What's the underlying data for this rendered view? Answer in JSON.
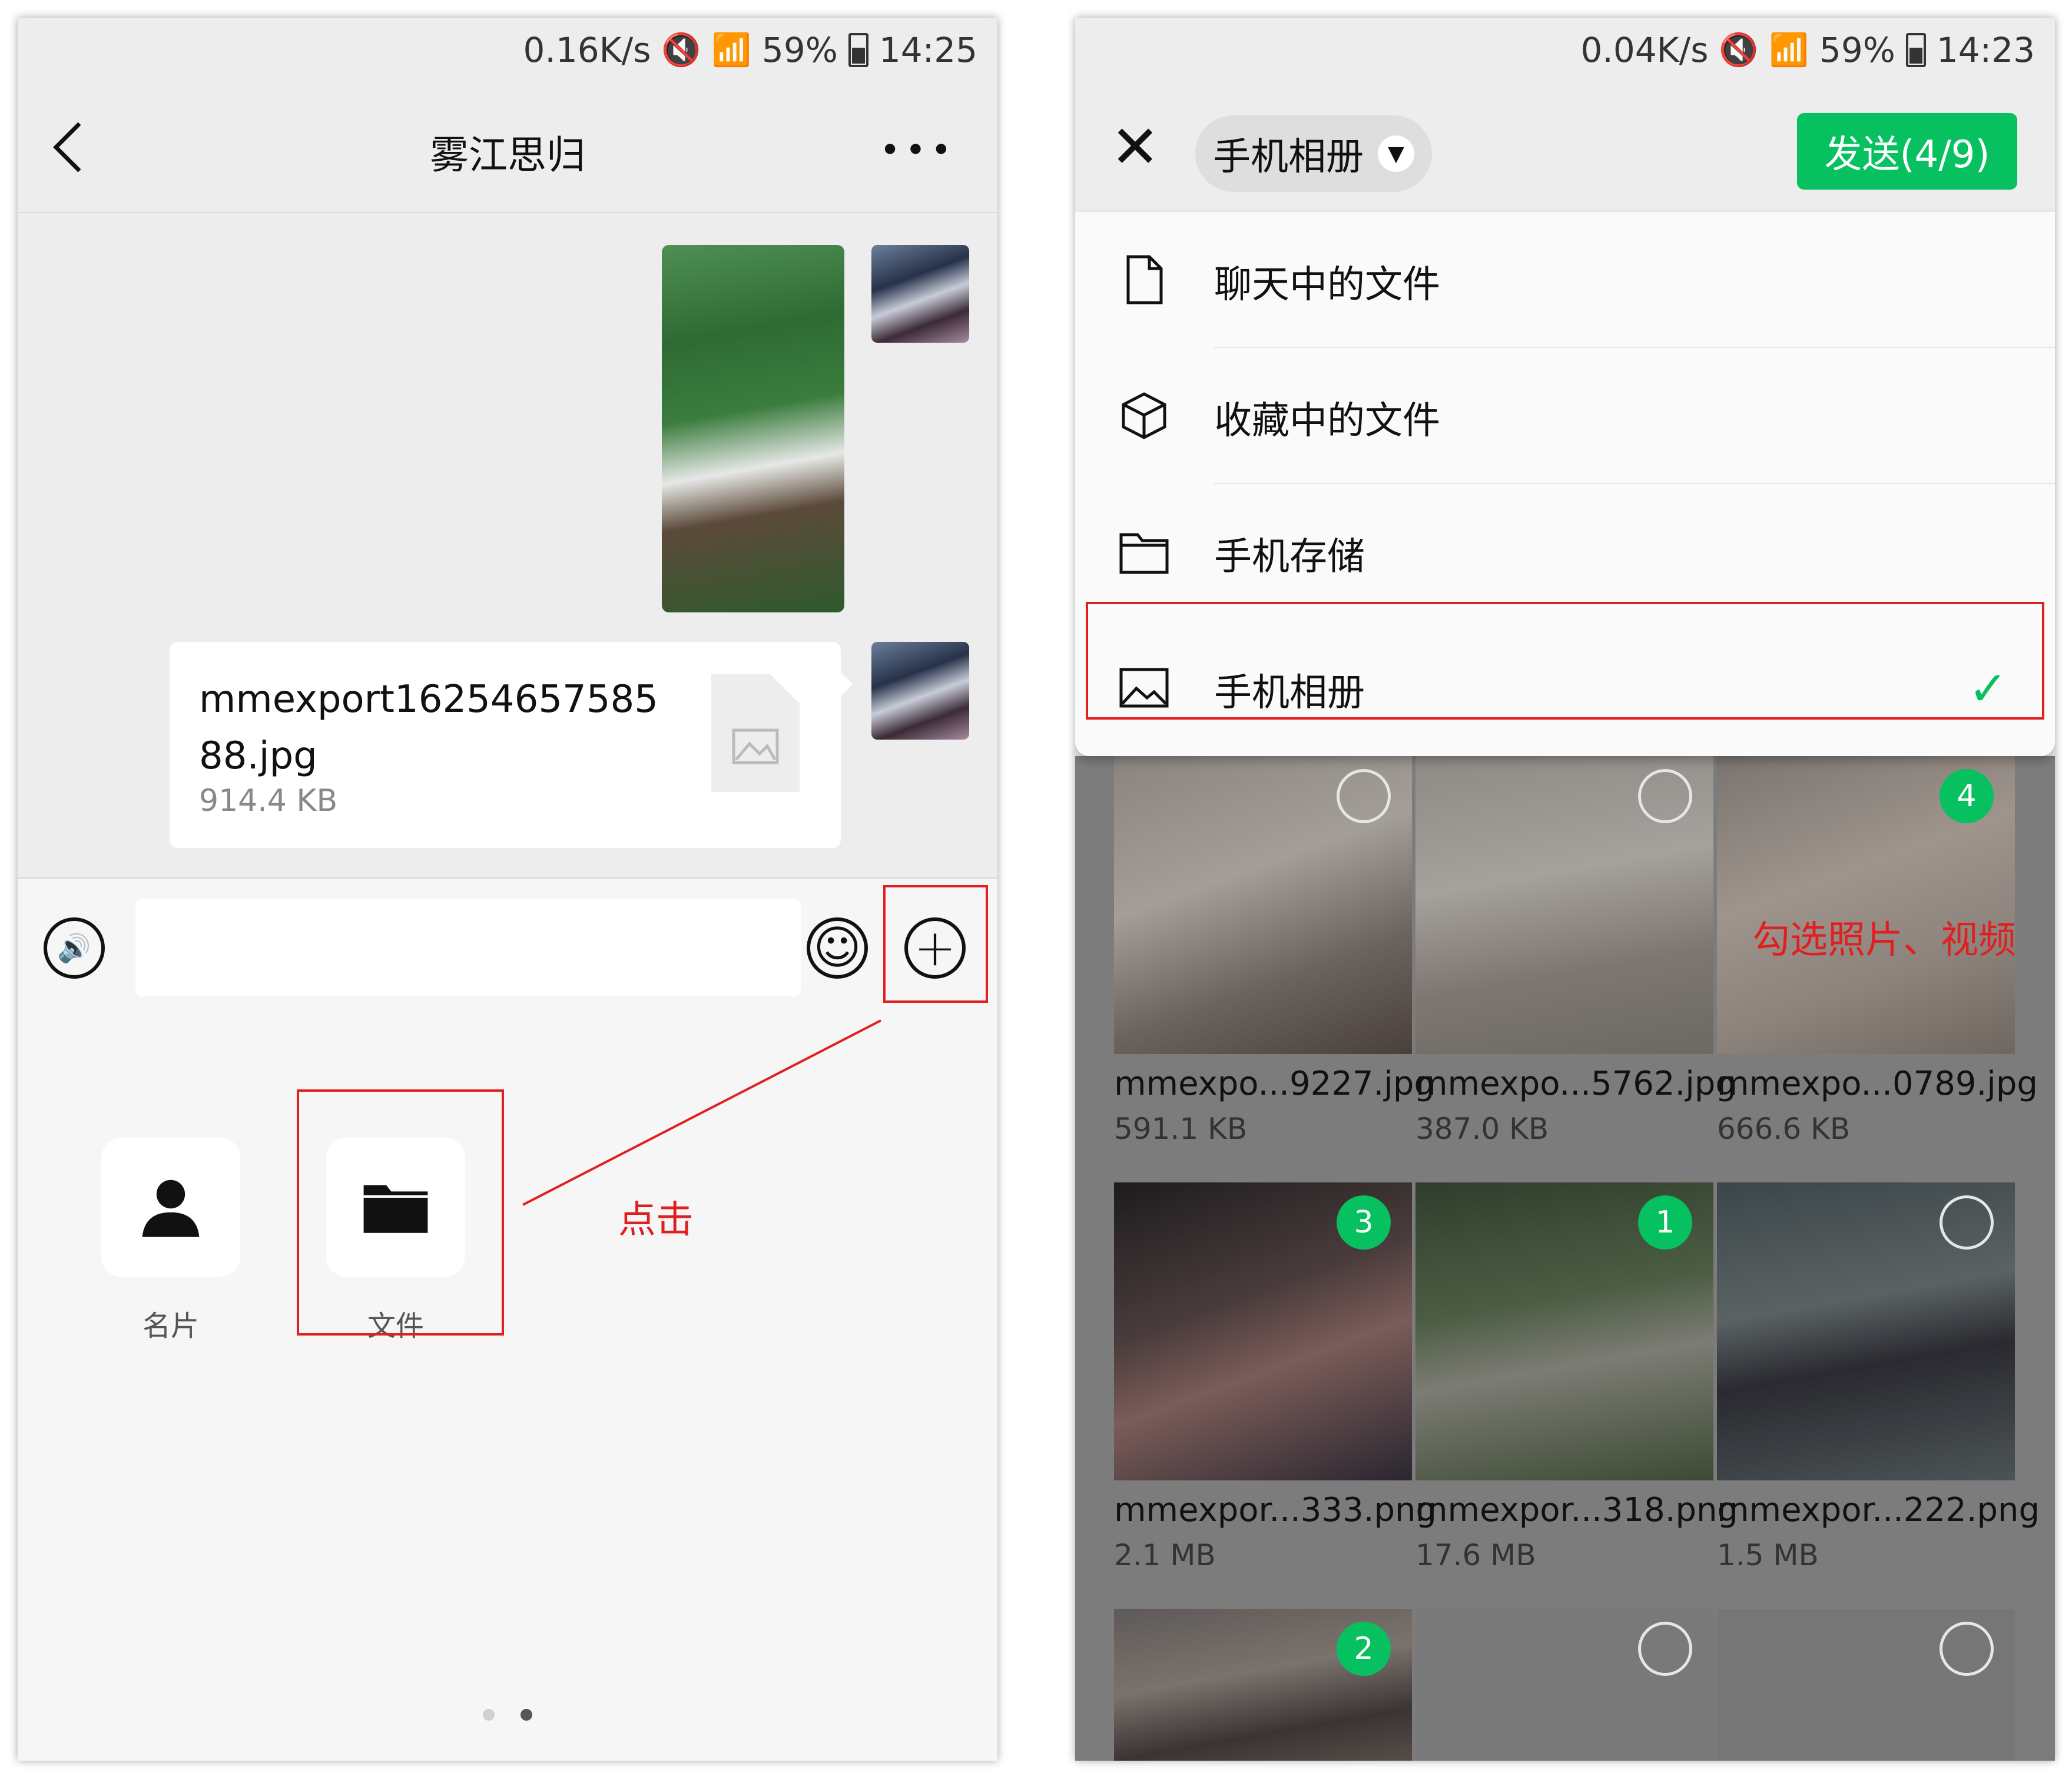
{
  "left": {
    "status": {
      "speed": "0.16K/s",
      "battery": "59%",
      "time": "14:25"
    },
    "header": {
      "title": "雾江思归"
    },
    "file_message": {
      "name": "mmexport1625465758588.jpg",
      "size": "914.4 KB"
    },
    "panel": {
      "items": [
        {
          "label": "名片",
          "icon": "person-icon"
        },
        {
          "label": "文件",
          "icon": "folder-icon"
        }
      ]
    },
    "annotation": {
      "click_label": "点击"
    }
  },
  "right": {
    "status": {
      "speed": "0.04K/s",
      "battery": "59%",
      "time": "14:23"
    },
    "header": {
      "album_selector": "手机相册",
      "send_button": "发送(4/9)"
    },
    "menu": [
      {
        "label": "聊天中的文件",
        "icon": "file-icon",
        "selected": false
      },
      {
        "label": "收藏中的文件",
        "icon": "cube-icon",
        "selected": false
      },
      {
        "label": "手机存储",
        "icon": "folder-outline-icon",
        "selected": false
      },
      {
        "label": "手机相册",
        "icon": "image-icon",
        "selected": true
      }
    ],
    "grid": [
      {
        "name": "mmexpo...9227.jpg",
        "size": "591.1 KB",
        "order": ""
      },
      {
        "name": "mmexpo...5762.jpg",
        "size": "387.0 KB",
        "order": ""
      },
      {
        "name": "mmexpo...0789.jpg",
        "size": "666.6 KB",
        "order": "4"
      },
      {
        "name": "mmexpor...333.png",
        "size": "2.1 MB",
        "order": "3"
      },
      {
        "name": "mmexpor...318.png",
        "size": "17.6 MB",
        "order": "1"
      },
      {
        "name": "mmexpor...222.png",
        "size": "1.5 MB",
        "order": ""
      },
      {
        "name": "",
        "size": "",
        "order": "2"
      },
      {
        "name": "",
        "size": "",
        "order": ""
      },
      {
        "name": "",
        "size": "",
        "order": ""
      }
    ],
    "annotation": {
      "select_label": "勾选照片、视频"
    }
  },
  "colors": {
    "accent": "#07c160",
    "annotation": "#e02020"
  }
}
